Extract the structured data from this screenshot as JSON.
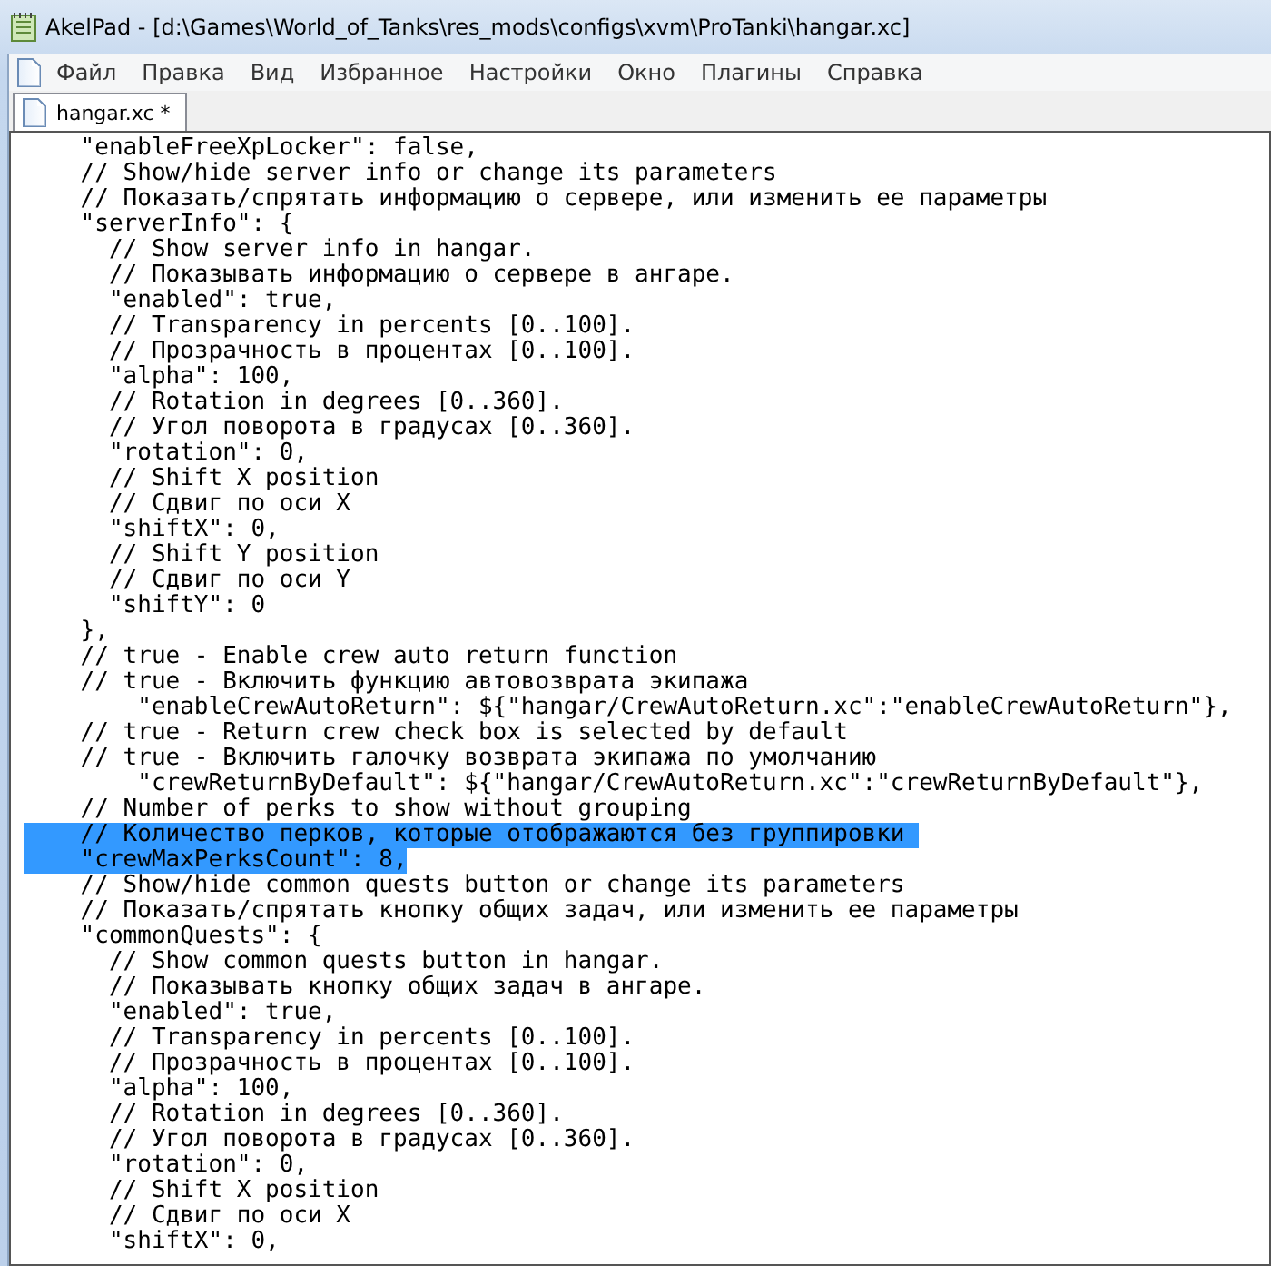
{
  "window": {
    "title": "AkelPad - [d:\\Games\\World_of_Tanks\\res_mods\\configs\\xvm\\ProTanki\\hangar.xc]"
  },
  "menu": [
    "Файл",
    "Правка",
    "Вид",
    "Избранное",
    "Настройки",
    "Окно",
    "Плагины",
    "Справка"
  ],
  "tabs": [
    {
      "label": "hangar.xc *",
      "selected": true
    }
  ],
  "editor": {
    "lines": [
      {
        "text": "    \"enableFreeXpLocker\": false,",
        "selected": false
      },
      {
        "text": "    // Show/hide server info or change its parameters",
        "selected": false
      },
      {
        "text": "    // Показать/спрятать информацию о сервере, или изменить ее параметры",
        "selected": false
      },
      {
        "text": "    \"serverInfo\": {",
        "selected": false
      },
      {
        "text": "      // Show server info in hangar.",
        "selected": false
      },
      {
        "text": "      // Показывать информацию о сервере в ангаре.",
        "selected": false
      },
      {
        "text": "      \"enabled\": true,",
        "selected": false
      },
      {
        "text": "      // Transparency in percents [0..100].",
        "selected": false
      },
      {
        "text": "      // Прозрачность в процентах [0..100].",
        "selected": false
      },
      {
        "text": "      \"alpha\": 100,",
        "selected": false
      },
      {
        "text": "      // Rotation in degrees [0..360].",
        "selected": false
      },
      {
        "text": "      // Угол поворота в градусах [0..360].",
        "selected": false
      },
      {
        "text": "      \"rotation\": 0,",
        "selected": false
      },
      {
        "text": "      // Shift X position",
        "selected": false
      },
      {
        "text": "      // Сдвиг по оси X",
        "selected": false
      },
      {
        "text": "      \"shiftX\": 0,",
        "selected": false
      },
      {
        "text": "      // Shift Y position",
        "selected": false
      },
      {
        "text": "      // Сдвиг по оси Y",
        "selected": false
      },
      {
        "text": "      \"shiftY\": 0",
        "selected": false
      },
      {
        "text": "    },",
        "selected": false
      },
      {
        "text": "    // true - Enable crew auto return function",
        "selected": false
      },
      {
        "text": "    // true - Включить функцию автовозврата экипажа",
        "selected": false
      },
      {
        "text": "        \"enableCrewAutoReturn\": ${\"hangar/CrewAutoReturn.xc\":\"enableCrewAutoReturn\"},",
        "selected": false
      },
      {
        "text": "    // true - Return crew check box is selected by default",
        "selected": false
      },
      {
        "text": "    // true - Включить галочку возврата экипажа по умолчанию",
        "selected": false
      },
      {
        "text": "        \"crewReturnByDefault\": ${\"hangar/CrewAutoReturn.xc\":\"crewReturnByDefault\"},",
        "selected": false
      },
      {
        "text": "    // Number of perks to show without grouping",
        "selected": false
      },
      {
        "text": "    // Количество перков, которые отображаются без группировки ",
        "selected": true
      },
      {
        "text": "    \"crewMaxPerksCount\": 8,",
        "selected": true
      },
      {
        "text": "    // Show/hide common quests button or change its parameters",
        "selected": false
      },
      {
        "text": "    // Показать/спрятать кнопку общих задач, или изменить ее параметры",
        "selected": false
      },
      {
        "text": "    \"commonQuests\": {",
        "selected": false
      },
      {
        "text": "      // Show common quests button in hangar.",
        "selected": false
      },
      {
        "text": "      // Показывать кнопку общих задач в ангаре.",
        "selected": false
      },
      {
        "text": "      \"enabled\": true,",
        "selected": false
      },
      {
        "text": "      // Transparency in percents [0..100].",
        "selected": false
      },
      {
        "text": "      // Прозрачность в процентах [0..100].",
        "selected": false
      },
      {
        "text": "      \"alpha\": 100,",
        "selected": false
      },
      {
        "text": "      // Rotation in degrees [0..360].",
        "selected": false
      },
      {
        "text": "      // Угол поворота в градусах [0..360].",
        "selected": false
      },
      {
        "text": "      \"rotation\": 0,",
        "selected": false
      },
      {
        "text": "      // Shift X position",
        "selected": false
      },
      {
        "text": "      // Сдвиг по оси X",
        "selected": false
      },
      {
        "text": "      \"shiftX\": 0,",
        "selected": false
      }
    ]
  }
}
